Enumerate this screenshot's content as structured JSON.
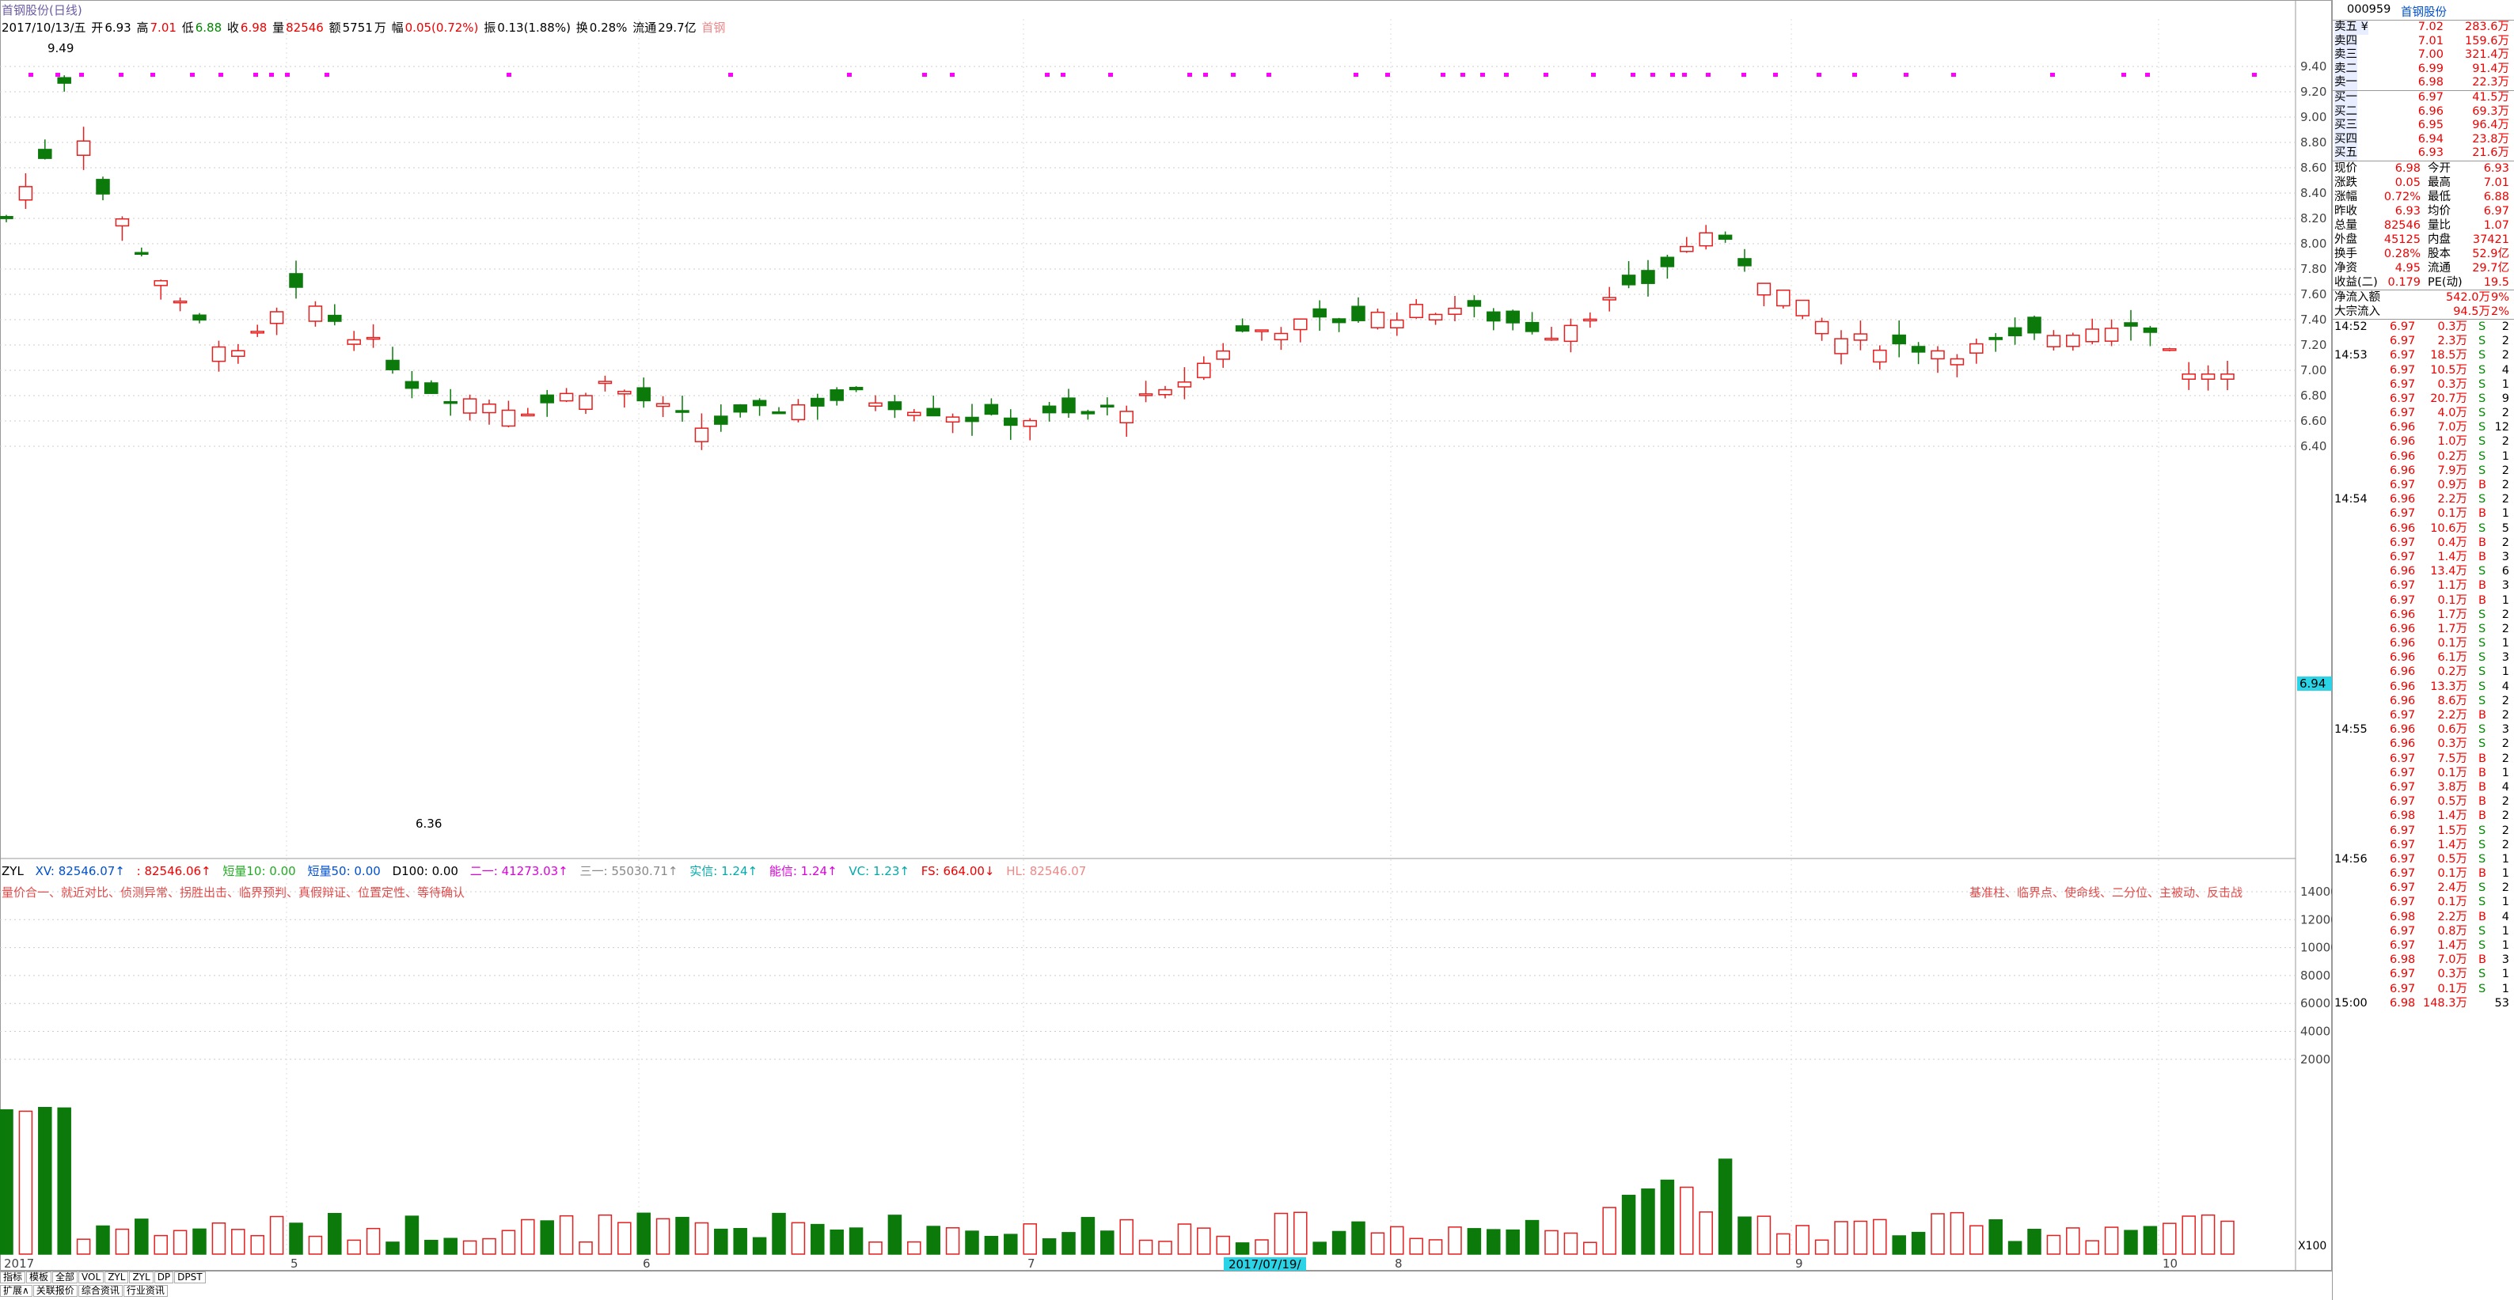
{
  "title": "首钢股份(日线)",
  "header": {
    "date": "2017/10/13/五",
    "open_l": "开",
    "open": "6.93",
    "high_l": "高",
    "high": "7.01",
    "low_l": "低",
    "low": "6.88",
    "close_l": "收",
    "close": "6.98",
    "vol_l": "量",
    "vol": "82546",
    "amt_l": "额",
    "amt": "5751",
    "amt_unit": "万",
    "chg_l": "幅",
    "chg": "0.05(0.72%)",
    "amp_l": "振",
    "amp": "0.13(1.88%)",
    "turn_l": "换",
    "turn": "0.28%",
    "flt_l": "流通",
    "flt": "29.7亿",
    "extra": "首钢"
  },
  "yaxis": [
    "9.40",
    "9.20",
    "9.00",
    "8.80",
    "8.60",
    "8.40",
    "8.20",
    "8.00",
    "7.80",
    "7.60",
    "7.40",
    "7.20",
    "7.00",
    "6.80",
    "6.60",
    "6.40"
  ],
  "vaxis": [
    "14000",
    "12000",
    "10000",
    "8000",
    "6000",
    "4000",
    "2000"
  ],
  "price_tag": "6.94",
  "peak_label": "9.49",
  "low_label": "6.36",
  "indicator": {
    "name": "ZYL",
    "xv": "XV: 82546.07↑",
    "b": ": 82546.06↑",
    "c": "短量10: 0.00",
    "d": "短量50: 0.00",
    "e": "D100: 0.00",
    "f": "二一: 41273.03↑",
    "g": "三一: 55030.71↑",
    "h": "实信: 1.24↑",
    "i": "能信: 1.24↑",
    "j": "VC: 1.23↑",
    "k": "FS: 664.00↓",
    "l": "HL: 82546.07"
  },
  "left_note": "量价合一、就近对比、侦测异常、拐胜出击、临界预判、真假辩证、位置定性、等待确认",
  "right_note": "基准柱、临界点、使命线、二分位、主被动、反击战",
  "xlabels": [
    "2017",
    "5",
    "6",
    "7",
    "8",
    "9",
    "10"
  ],
  "date_tag": "2017/07/19/",
  "x100": "X100",
  "bottom_tabs": [
    "指标",
    "模板",
    "全部",
    "VOL",
    "ZYL",
    "ZYL",
    "DP",
    "DPST"
  ],
  "bottom_tabs2": [
    "扩展∧",
    "关联报价",
    "综合资讯",
    "行业资讯"
  ],
  "rp": {
    "code": "000959",
    "name": "首钢股份",
    "sells": [
      {
        "l": "卖五 ¥",
        "p": "7.02",
        "v": "283.6万"
      },
      {
        "l": "卖四",
        "p": "7.01",
        "v": "159.6万"
      },
      {
        "l": "卖三",
        "p": "7.00",
        "v": "321.4万"
      },
      {
        "l": "卖二",
        "p": "6.99",
        "v": "91.4万"
      },
      {
        "l": "卖一",
        "p": "6.98",
        "v": "22.3万"
      }
    ],
    "buys": [
      {
        "l": "买一",
        "p": "6.97",
        "v": "41.5万"
      },
      {
        "l": "买二",
        "p": "6.96",
        "v": "69.3万"
      },
      {
        "l": "买三",
        "p": "6.95",
        "v": "96.4万"
      },
      {
        "l": "买四",
        "p": "6.94",
        "v": "23.8万"
      },
      {
        "l": "买五",
        "p": "6.93",
        "v": "21.6万"
      }
    ],
    "quote": [
      [
        "现价",
        "6.98",
        "今开",
        "6.93"
      ],
      [
        "涨跌",
        "0.05",
        "最高",
        "7.01"
      ],
      [
        "涨幅",
        "0.72%",
        "最低",
        "6.88"
      ],
      [
        "昨收",
        "6.93",
        "均价",
        "6.97"
      ],
      [
        "总量",
        "82546",
        "量比",
        "1.07"
      ],
      [
        "外盘",
        "45125",
        "内盘",
        "37421"
      ],
      [
        "换手",
        "0.28%",
        "股本",
        "52.9亿"
      ],
      [
        "净资",
        "4.95",
        "流通",
        "29.7亿"
      ],
      [
        "收益(二)",
        "0.179",
        "PE(动)",
        "19.5"
      ]
    ],
    "flows": [
      [
        "净流入额",
        "542.0万",
        "9%"
      ],
      [
        "大宗流入",
        "94.5万",
        "2%"
      ]
    ],
    "ticks": [
      [
        "14:52",
        "6.97",
        "0.3万",
        "S",
        "2"
      ],
      [
        "",
        "6.97",
        "2.3万",
        "S",
        "2"
      ],
      [
        "14:53",
        "6.97",
        "18.5万",
        "S",
        "2"
      ],
      [
        "",
        "6.97",
        "10.5万",
        "S",
        "4"
      ],
      [
        "",
        "6.97",
        "0.3万",
        "S",
        "1"
      ],
      [
        "",
        "6.97",
        "20.7万",
        "S",
        "9"
      ],
      [
        "",
        "6.97",
        "4.0万",
        "S",
        "2"
      ],
      [
        "",
        "6.96",
        "7.0万",
        "S",
        "12"
      ],
      [
        "",
        "6.96",
        "1.0万",
        "S",
        "2"
      ],
      [
        "",
        "6.96",
        "0.2万",
        "S",
        "1"
      ],
      [
        "",
        "6.96",
        "7.9万",
        "S",
        "2"
      ],
      [
        "",
        "6.97",
        "0.9万",
        "B",
        "2"
      ],
      [
        "14:54",
        "6.96",
        "2.2万",
        "S",
        "2"
      ],
      [
        "",
        "6.97",
        "0.1万",
        "B",
        "1"
      ],
      [
        "",
        "6.96",
        "10.6万",
        "S",
        "5"
      ],
      [
        "",
        "6.97",
        "0.4万",
        "B",
        "2"
      ],
      [
        "",
        "6.97",
        "1.4万",
        "B",
        "3"
      ],
      [
        "",
        "6.96",
        "13.4万",
        "S",
        "6"
      ],
      [
        "",
        "6.97",
        "1.1万",
        "B",
        "3"
      ],
      [
        "",
        "6.97",
        "0.1万",
        "B",
        "1"
      ],
      [
        "",
        "6.96",
        "1.7万",
        "S",
        "2"
      ],
      [
        "",
        "6.96",
        "1.7万",
        "S",
        "2"
      ],
      [
        "",
        "6.96",
        "0.1万",
        "S",
        "1"
      ],
      [
        "",
        "6.96",
        "6.1万",
        "S",
        "3"
      ],
      [
        "",
        "6.96",
        "0.2万",
        "S",
        "1"
      ],
      [
        "",
        "6.96",
        "13.3万",
        "S",
        "4"
      ],
      [
        "",
        "6.96",
        "8.6万",
        "S",
        "2"
      ],
      [
        "",
        "6.97",
        "2.2万",
        "B",
        "2"
      ],
      [
        "14:55",
        "6.96",
        "0.6万",
        "S",
        "3"
      ],
      [
        "",
        "6.96",
        "0.3万",
        "S",
        "2"
      ],
      [
        "",
        "6.97",
        "7.5万",
        "B",
        "2"
      ],
      [
        "",
        "6.97",
        "0.1万",
        "B",
        "1"
      ],
      [
        "",
        "6.97",
        "3.8万",
        "B",
        "4"
      ],
      [
        "",
        "6.97",
        "0.5万",
        "B",
        "2"
      ],
      [
        "",
        "6.98",
        "1.4万",
        "B",
        "2"
      ],
      [
        "",
        "6.97",
        "1.5万",
        "S",
        "2"
      ],
      [
        "",
        "6.97",
        "1.4万",
        "S",
        "2"
      ],
      [
        "14:56",
        "6.97",
        "0.5万",
        "S",
        "1"
      ],
      [
        "",
        "6.97",
        "0.1万",
        "B",
        "1"
      ],
      [
        "",
        "6.97",
        "2.4万",
        "S",
        "2"
      ],
      [
        "",
        "6.97",
        "0.1万",
        "S",
        "1"
      ],
      [
        "",
        "6.98",
        "2.2万",
        "B",
        "4"
      ],
      [
        "",
        "6.97",
        "0.8万",
        "S",
        "1"
      ],
      [
        "",
        "6.97",
        "1.4万",
        "S",
        "1"
      ],
      [
        "",
        "6.98",
        "7.0万",
        "B",
        "3"
      ],
      [
        "",
        "6.97",
        "0.3万",
        "S",
        "1"
      ],
      [
        "",
        "6.97",
        "0.1万",
        "S",
        "1"
      ],
      [
        "15:00",
        "6.98",
        "148.3万",
        "",
        "53"
      ]
    ]
  }
}
